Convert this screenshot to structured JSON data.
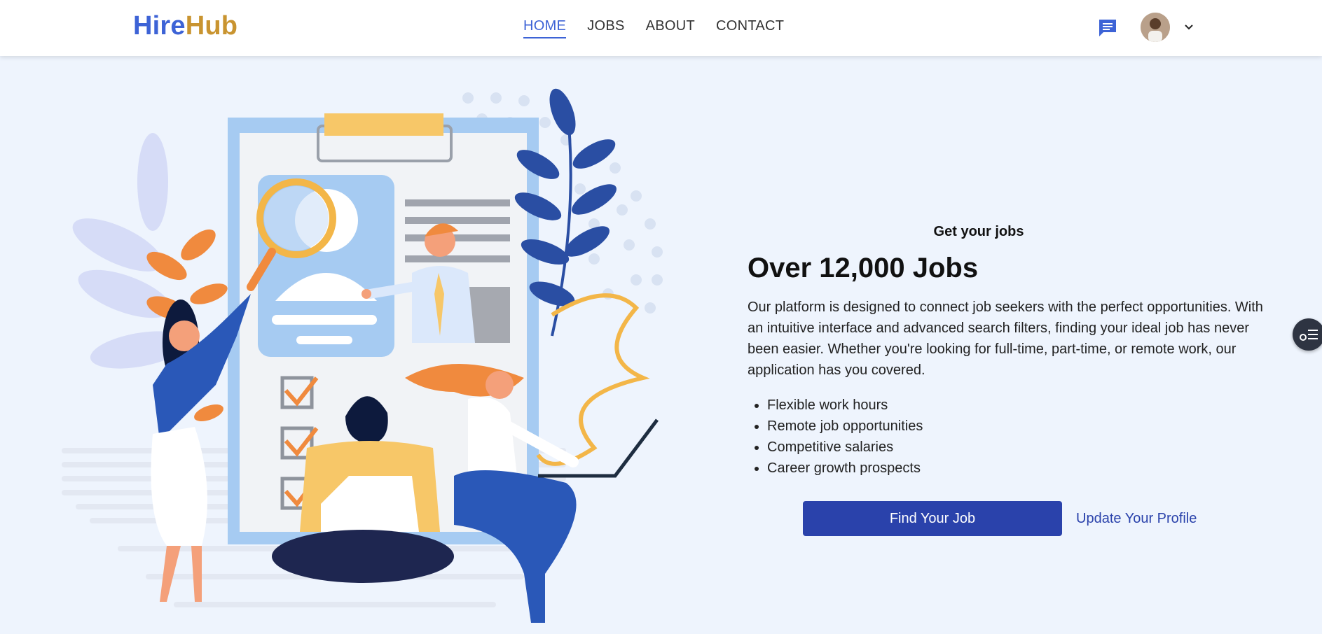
{
  "brand": {
    "part1": "Hire",
    "part2": "Hub",
    "color1": "#3d63d6",
    "color2": "#c99430"
  },
  "nav": {
    "items": [
      {
        "label": "HOME",
        "active": true
      },
      {
        "label": "JOBS",
        "active": false
      },
      {
        "label": "ABOUT",
        "active": false
      },
      {
        "label": "CONTACT",
        "active": false
      }
    ]
  },
  "header_icons": {
    "messages": "chat-icon",
    "profile": "avatar",
    "menu": "chevron-down-icon"
  },
  "hero": {
    "eyebrow": "Get your jobs",
    "headline": "Over 12,000 Jobs",
    "description": "Our platform is designed to connect job seekers with the perfect opportunities. With an intuitive interface and advanced search filters, finding your ideal job has never been easier. Whether you're looking for full-time, part-time, or remote work, our application has you covered.",
    "features": [
      "Flexible work hours",
      "Remote job opportunities",
      "Competitive salaries",
      "Career growth prospects"
    ],
    "primary_cta": "Find Your Job",
    "secondary_cta": "Update Your Profile"
  },
  "colors": {
    "accent": "#2a42ab",
    "background": "#eef4fd"
  }
}
